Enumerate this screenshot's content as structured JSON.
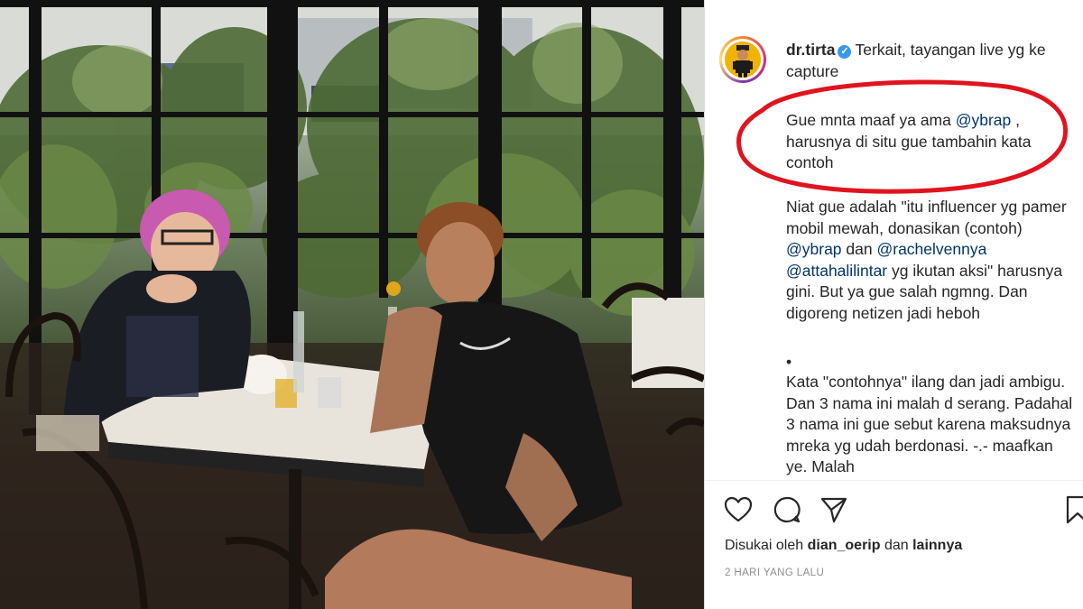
{
  "post": {
    "username": "dr.tirta",
    "verified_icon": "verified-badge-icon",
    "caption_intro": "Terkait, tayangan live yg ke capture",
    "apology": {
      "before": "Gue mnta maaf ya ama ",
      "mention": "@ybrap",
      "after": " , harusnya di situ gue tambahin kata contoh"
    },
    "intent": {
      "part1": "Niat gue adalah \"itu influencer yg pamer mobil mewah, donasikan (contoh) ",
      "mention1": "@ybrap",
      "part2": " dan ",
      "mention2": "@rachelvennya",
      "part3": " ",
      "mention3": "@attahalilintar",
      "part4": " yg ikutan aksi\" harusnya gini. But ya gue salah ngmng. Dan digoreng netizen jadi heboh"
    },
    "bullet": "•",
    "explanation": "Kata \"contohnya\" ilang dan jadi ambigu. Dan 3 nama ini malah d serang. Padahal 3 nama ini gue sebut karena maksudnya mreka yg udah berdonasi. -.- maafkan ye. Malah",
    "likes": {
      "prefix": "Disukai oleh ",
      "user": "dian_oerip",
      "middle": " dan ",
      "others": "lainnya"
    },
    "timestamp": "2 HARI YANG LALU",
    "actions": [
      "heart-icon",
      "comment-icon",
      "share-icon",
      "bookmark-icon"
    ]
  },
  "colors": {
    "annotation_ellipse": "#e0141e",
    "mention": "#003569",
    "verified": "#3897f0",
    "muted_text": "#8e8e8e"
  }
}
